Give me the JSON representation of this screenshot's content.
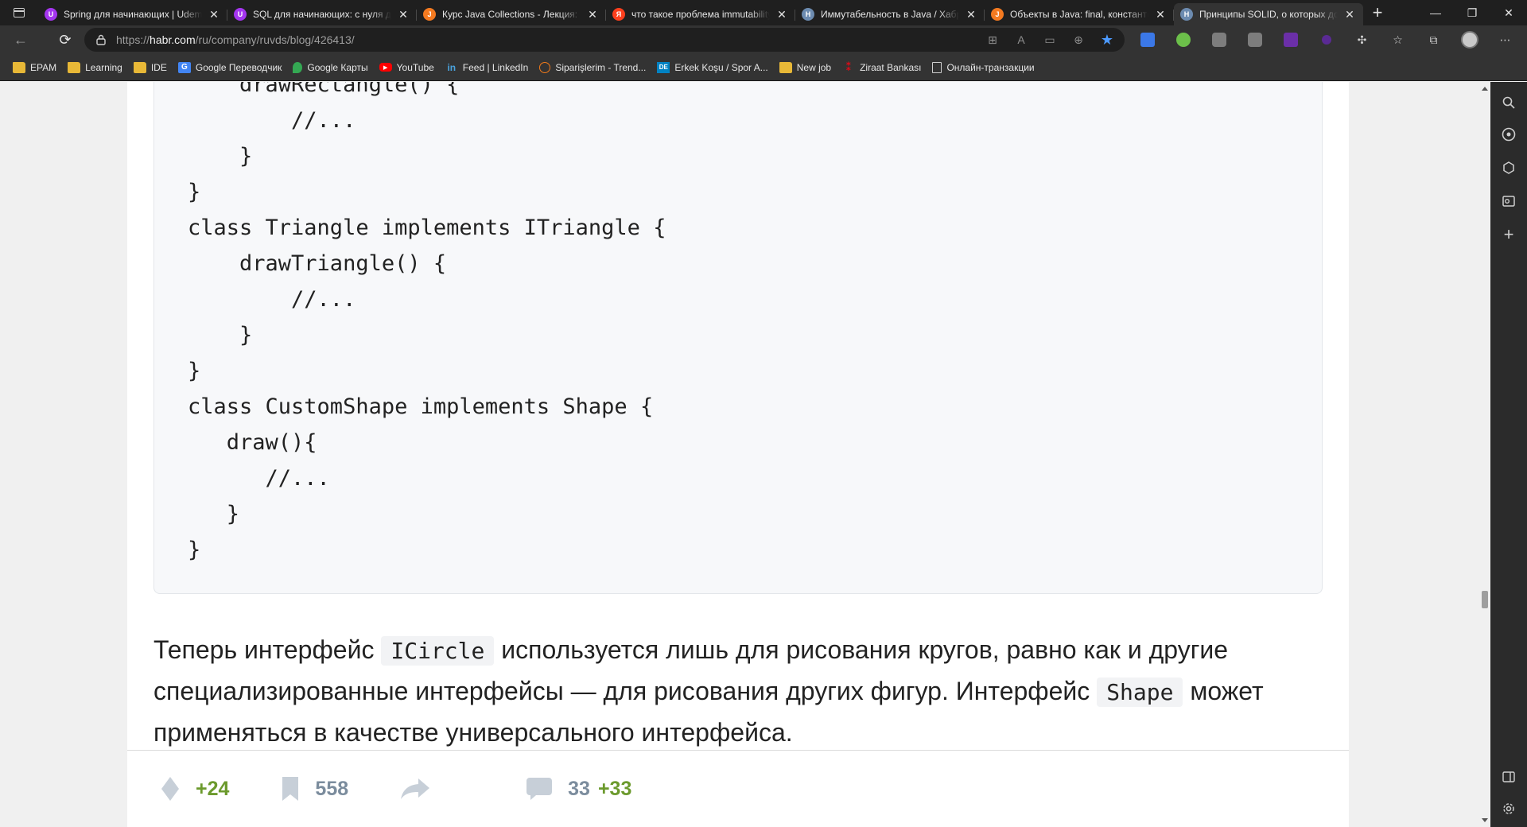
{
  "browser": {
    "tabs": [
      {
        "title": "Spring для начинающих | Udemy",
        "favicon": "udemy",
        "color": "#a435f0",
        "glyph": "U",
        "active": false
      },
      {
        "title": "SQL для начинающих: с нуля до сертификата",
        "favicon": "udemy",
        "color": "#a435f0",
        "glyph": "U",
        "active": false
      },
      {
        "title": "Курс Java Collections - Лекция: Что такое",
        "favicon": "javarush",
        "color": "#f47a20",
        "glyph": "J",
        "active": false
      },
      {
        "title": "что такое проблема immutability",
        "favicon": "yandex",
        "color": "#fc3f1d",
        "glyph": "Я",
        "active": false
      },
      {
        "title": "Иммутабельность в Java / Хабр",
        "favicon": "habr",
        "color": "#6c8bb0",
        "glyph": "H",
        "active": false
      },
      {
        "title": "Объекты в Java: final, константы",
        "favicon": "javarush",
        "color": "#f47a20",
        "glyph": "J",
        "active": false
      },
      {
        "title": "Принципы SOLID, о которых должен знать",
        "favicon": "habr",
        "color": "#6c8bb0",
        "glyph": "H",
        "active": true
      }
    ],
    "new_tab_label": "+",
    "close_glyph": "✕",
    "url": {
      "scheme": "https://",
      "host": "habr.com",
      "path": "/ru/company/ruvds/blog/426413/"
    },
    "bookmarks": [
      {
        "label": "EPAM",
        "icon": "folder-icon"
      },
      {
        "label": "Learning",
        "icon": "folder-icon"
      },
      {
        "label": "IDE",
        "icon": "folder-icon"
      },
      {
        "label": "Google Переводчик",
        "icon": "google-translate-icon"
      },
      {
        "label": "Google Карты",
        "icon": "google-maps-icon"
      },
      {
        "label": "YouTube",
        "icon": "youtube-icon"
      },
      {
        "label": "Feed | LinkedIn",
        "icon": "linkedin-icon"
      },
      {
        "label": "Siparişlerim - Trend...",
        "icon": "trendyol-icon"
      },
      {
        "label": "Erkek Koşu / Spor A...",
        "icon": "decathlon-icon"
      },
      {
        "label": "New job",
        "icon": "folder-icon"
      },
      {
        "label": "Ziraat Bankası",
        "icon": "ziraat-icon"
      },
      {
        "label": "Онлайн-транзакции",
        "icon": "page-icon"
      }
    ]
  },
  "article": {
    "code_lines": [
      "    drawRectangle() {",
      "        //...",
      "    }",
      "}",
      "class Triangle implements ITriangle {",
      "    drawTriangle() {",
      "        //...",
      "    }",
      "}",
      "class CustomShape implements Shape {",
      "   draw(){",
      "      //...",
      "   }",
      "}"
    ],
    "paragraph": {
      "part1": "Теперь интерфейс ",
      "code1": "ICircle",
      "part2": " используется лишь для рисования кругов, равно как и другие специализированные интерфейсы — для рисования других фигур. Интерфейс ",
      "code2": "Shape",
      "part3": " может применяться в качестве универсального интерфейса."
    },
    "footer": {
      "rating": "+24",
      "bookmarks": "558",
      "comments": "33",
      "new_comments": "+33"
    }
  },
  "colors": {
    "accent_green": "#6c9a2d",
    "stat_gray": "#7b8c9d",
    "code_bg": "#f7f8fa"
  }
}
